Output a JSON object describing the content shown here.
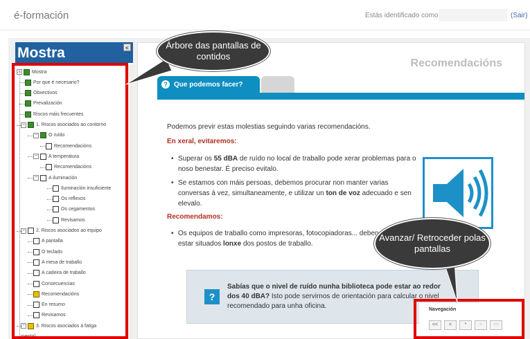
{
  "header": {
    "brand": "é-formación",
    "identified_as": "Estás identificado como",
    "logout": "(Sair)"
  },
  "sidebar": {
    "title": "Mostra",
    "collapse": "<",
    "items": [
      {
        "label": "Mostra",
        "icon": "green"
      },
      {
        "label": "Por que é necesario?",
        "icon": "green"
      },
      {
        "label": "Obxectivos",
        "icon": "green"
      },
      {
        "label": "Prevalización",
        "icon": "green"
      },
      {
        "label": "Riscos máis frecuentes",
        "icon": "green"
      },
      {
        "label": "1. Riscos asociados ao contorno",
        "icon": "green"
      },
      {
        "label": "O ruído",
        "icon": "green"
      },
      {
        "label": "Recomendacións",
        "icon": "box"
      },
      {
        "label": "A temperatura",
        "icon": "box"
      },
      {
        "label": "Recomendacións",
        "icon": "box"
      },
      {
        "label": "A iluminación",
        "icon": "box"
      },
      {
        "label": "Iluminación insuficiente",
        "icon": "box"
      },
      {
        "label": "Os reflexos",
        "icon": "box"
      },
      {
        "label": "Os cegamentos",
        "icon": "box"
      },
      {
        "label": "Revisamos",
        "icon": "box"
      },
      {
        "label": "2. Riscos asociados ao equipo",
        "icon": "box"
      },
      {
        "label": "A pantalla",
        "icon": "box"
      },
      {
        "label": "O teclado",
        "icon": "box"
      },
      {
        "label": "A mesa de traballo",
        "icon": "box"
      },
      {
        "label": "A cadeira de traballo",
        "icon": "box"
      },
      {
        "label": "Consecuencias",
        "icon": "box"
      },
      {
        "label": "Recomendacións",
        "icon": "check"
      },
      {
        "label": "En resumo",
        "icon": "box"
      },
      {
        "label": "Revisamos",
        "icon": "box"
      },
      {
        "label": "3. Riscos asociados á fatiga",
        "icon": "check"
      },
      {
        "label": "mental",
        "icon": "none"
      }
    ]
  },
  "content": {
    "heading": "Recomendacións",
    "tab_active": "Que podemos facer?",
    "intro": "Podemos previr estas molestias seguindo varias recomendacións.",
    "section1": "En xeral, evitaremos:",
    "bullet1_a": "Superar os ",
    "bullet1_b": "55 dBA",
    "bullet1_c": " de ruído no local de traballo pode xerar problemas para o noso benestar. É preciso evitalo.",
    "bullet2_a": "Se estamos con máis persoas, debemos procurar non manter varias conversas á vez, simultaneamente, e utilizar un ",
    "bullet2_b": "ton de voz",
    "bullet2_c": " adecuado e sen elevalo.",
    "section2": "Recomendamos:",
    "bullet3_a": "Os equipos de traballo como impresoras, fotocopiadoras... deben estar situados ",
    "bullet3_b": "lonxe",
    "bullet3_c": " dos postos de traballo.",
    "info_bold": "Sabías que o nivel de ruído nunha biblioteca pode estar ao redor dos 40 dBA?",
    "info_rest": " Isto pode servirnos de orientación para calcular o nivel recomendado para unha oficina."
  },
  "navigation": {
    "title": "Navegación",
    "first": "<<",
    "prev": "<",
    "current": "*",
    "next": ">",
    "last": ">>"
  },
  "callouts": {
    "tree": "Árbore das pantallas de contidos",
    "nav": "Avanzar/ Retroceder polas pantallas"
  },
  "colors": {
    "accent_blue": "#0f8ec1",
    "title_blue": "#21619f",
    "highlight_red": "#e00000",
    "section_red": "#b03020"
  }
}
